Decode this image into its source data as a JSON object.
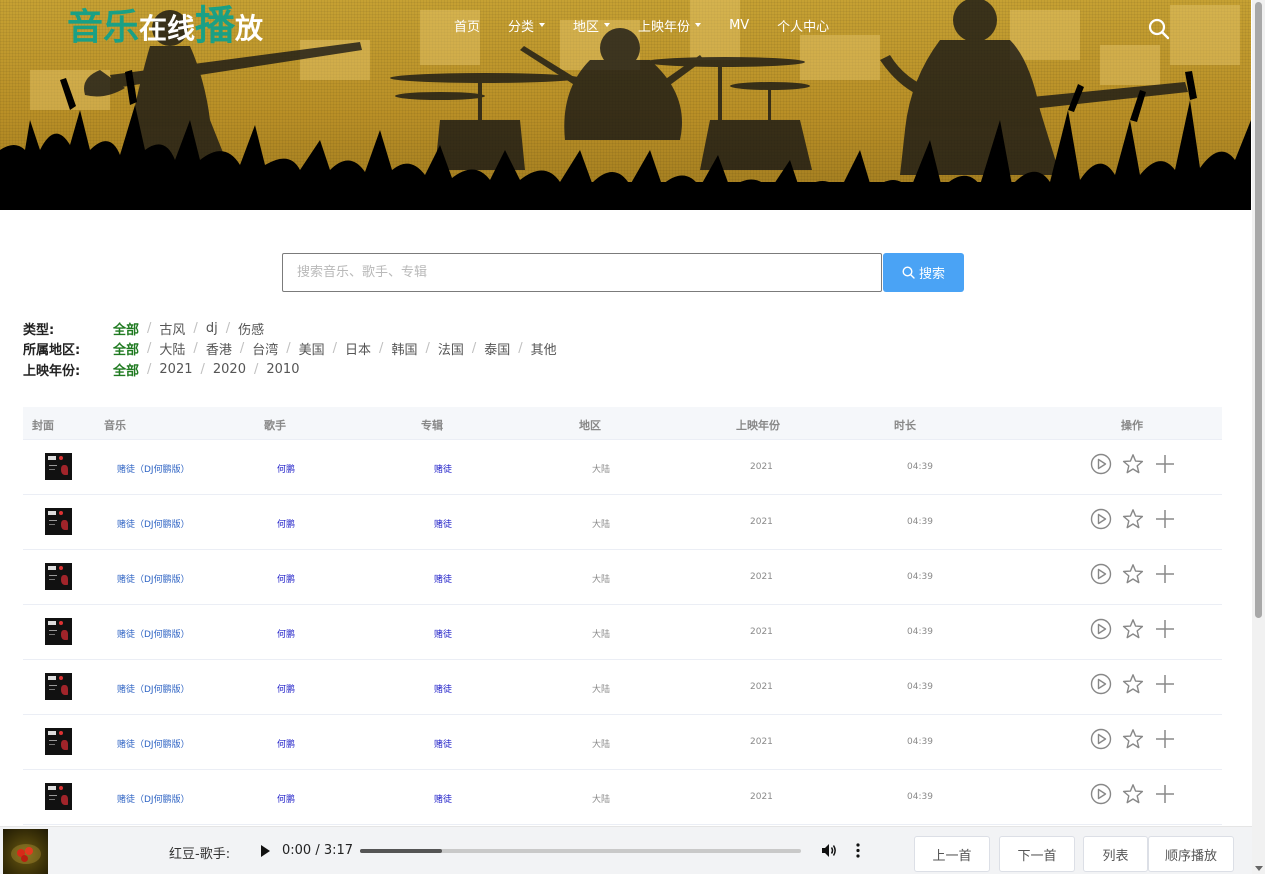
{
  "logo": {
    "part1": "音乐",
    "part2": "在线",
    "part3": "播",
    "part4": "放"
  },
  "nav": {
    "items": [
      {
        "label": "首页",
        "dropdown": false
      },
      {
        "label": "分类",
        "dropdown": true
      },
      {
        "label": "地区",
        "dropdown": true
      },
      {
        "label": "上映年份",
        "dropdown": true
      },
      {
        "label": "MV",
        "dropdown": false
      },
      {
        "label": "个人中心",
        "dropdown": false
      }
    ],
    "search_icon": "search-icon"
  },
  "search": {
    "placeholder": "搜索音乐、歌手、专辑",
    "value": "",
    "button_label": "搜索"
  },
  "filters": {
    "type": {
      "label": "类型:",
      "options": [
        "全部",
        "古风",
        "dj",
        "伤感"
      ],
      "active": "全部"
    },
    "region": {
      "label": "所属地区:",
      "options": [
        "全部",
        "大陆",
        "香港",
        "台湾",
        "美国",
        "日本",
        "韩国",
        "法国",
        "泰国",
        "其他"
      ],
      "active": "全部"
    },
    "year": {
      "label": "上映年份:",
      "options": [
        "全部",
        "2021",
        "2020",
        "2010"
      ],
      "active": "全部"
    }
  },
  "table": {
    "headers": [
      "封面",
      "音乐",
      "歌手",
      "专辑",
      "地区",
      "上映年份",
      "时长",
      "操作"
    ],
    "rows": [
      {
        "title": "赌徒（DJ何鹏版）",
        "artist": "何鹏",
        "album": "赌徒",
        "region": "大陆",
        "year": "2021",
        "duration": "04:39"
      },
      {
        "title": "赌徒（DJ何鹏版）",
        "artist": "何鹏",
        "album": "赌徒",
        "region": "大陆",
        "year": "2021",
        "duration": "04:39"
      },
      {
        "title": "赌徒（DJ何鹏版）",
        "artist": "何鹏",
        "album": "赌徒",
        "region": "大陆",
        "year": "2021",
        "duration": "04:39"
      },
      {
        "title": "赌徒（DJ何鹏版）",
        "artist": "何鹏",
        "album": "赌徒",
        "region": "大陆",
        "year": "2021",
        "duration": "04:39"
      },
      {
        "title": "赌徒（DJ何鹏版）",
        "artist": "何鹏",
        "album": "赌徒",
        "region": "大陆",
        "year": "2021",
        "duration": "04:39"
      },
      {
        "title": "赌徒（DJ何鹏版）",
        "artist": "何鹏",
        "album": "赌徒",
        "region": "大陆",
        "year": "2021",
        "duration": "04:39"
      },
      {
        "title": "赌徒（DJ何鹏版）",
        "artist": "何鹏",
        "album": "赌徒",
        "region": "大陆",
        "year": "2021",
        "duration": "04:39"
      }
    ],
    "row_actions": [
      "play-circle-icon",
      "star-icon",
      "plus-icon"
    ]
  },
  "player": {
    "now_playing": "红豆-歌手:",
    "time": "0:00 / 3:17",
    "progress_fraction": 0.185,
    "buttons": {
      "prev": "上一首",
      "next": "下一首",
      "list": "列表",
      "mode": "顺序播放"
    }
  },
  "colors": {
    "brand_green": "#1aa085",
    "search_button": "#4aa3f5",
    "filter_active": "#1f7a20",
    "link_blue": "#2f64c4",
    "banner_gold": "#c6a133"
  }
}
